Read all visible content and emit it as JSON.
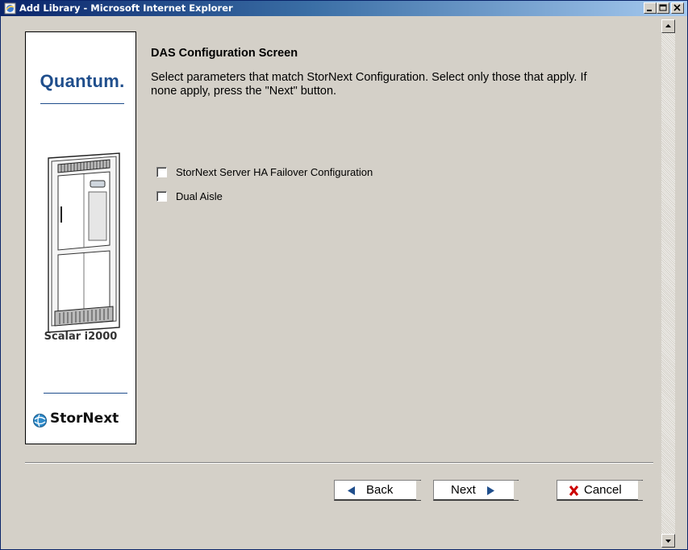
{
  "window": {
    "title": "Add Library - Microsoft Internet Explorer",
    "controls": [
      "minimize",
      "maximize",
      "close"
    ]
  },
  "sidebar": {
    "brand": "Quantum.",
    "product_name": "Scalar i2000",
    "footer_brand": "StorNext",
    "icons": [
      "library-cabinet-image",
      "stornext-globe-icon"
    ]
  },
  "main": {
    "title": "DAS Configuration Screen",
    "instruction": "Select parameters that match StorNext Configuration. Select only those that apply. If none apply, press the \"Next\" button.",
    "options": [
      {
        "label": "StorNext Server HA Failover Configuration",
        "checked": false
      },
      {
        "label": "Dual Aisle",
        "checked": false
      }
    ]
  },
  "buttons": {
    "back_label": "Back",
    "next_label": "Next",
    "cancel_label": "Cancel"
  },
  "colors": {
    "titlebar_start": "#0a246a",
    "titlebar_end": "#a6caf0",
    "brand_blue": "#1f4e8c",
    "arrow_blue": "#1f4e8c",
    "cancel_red": "#cc0000",
    "background": "#d4d0c8"
  }
}
